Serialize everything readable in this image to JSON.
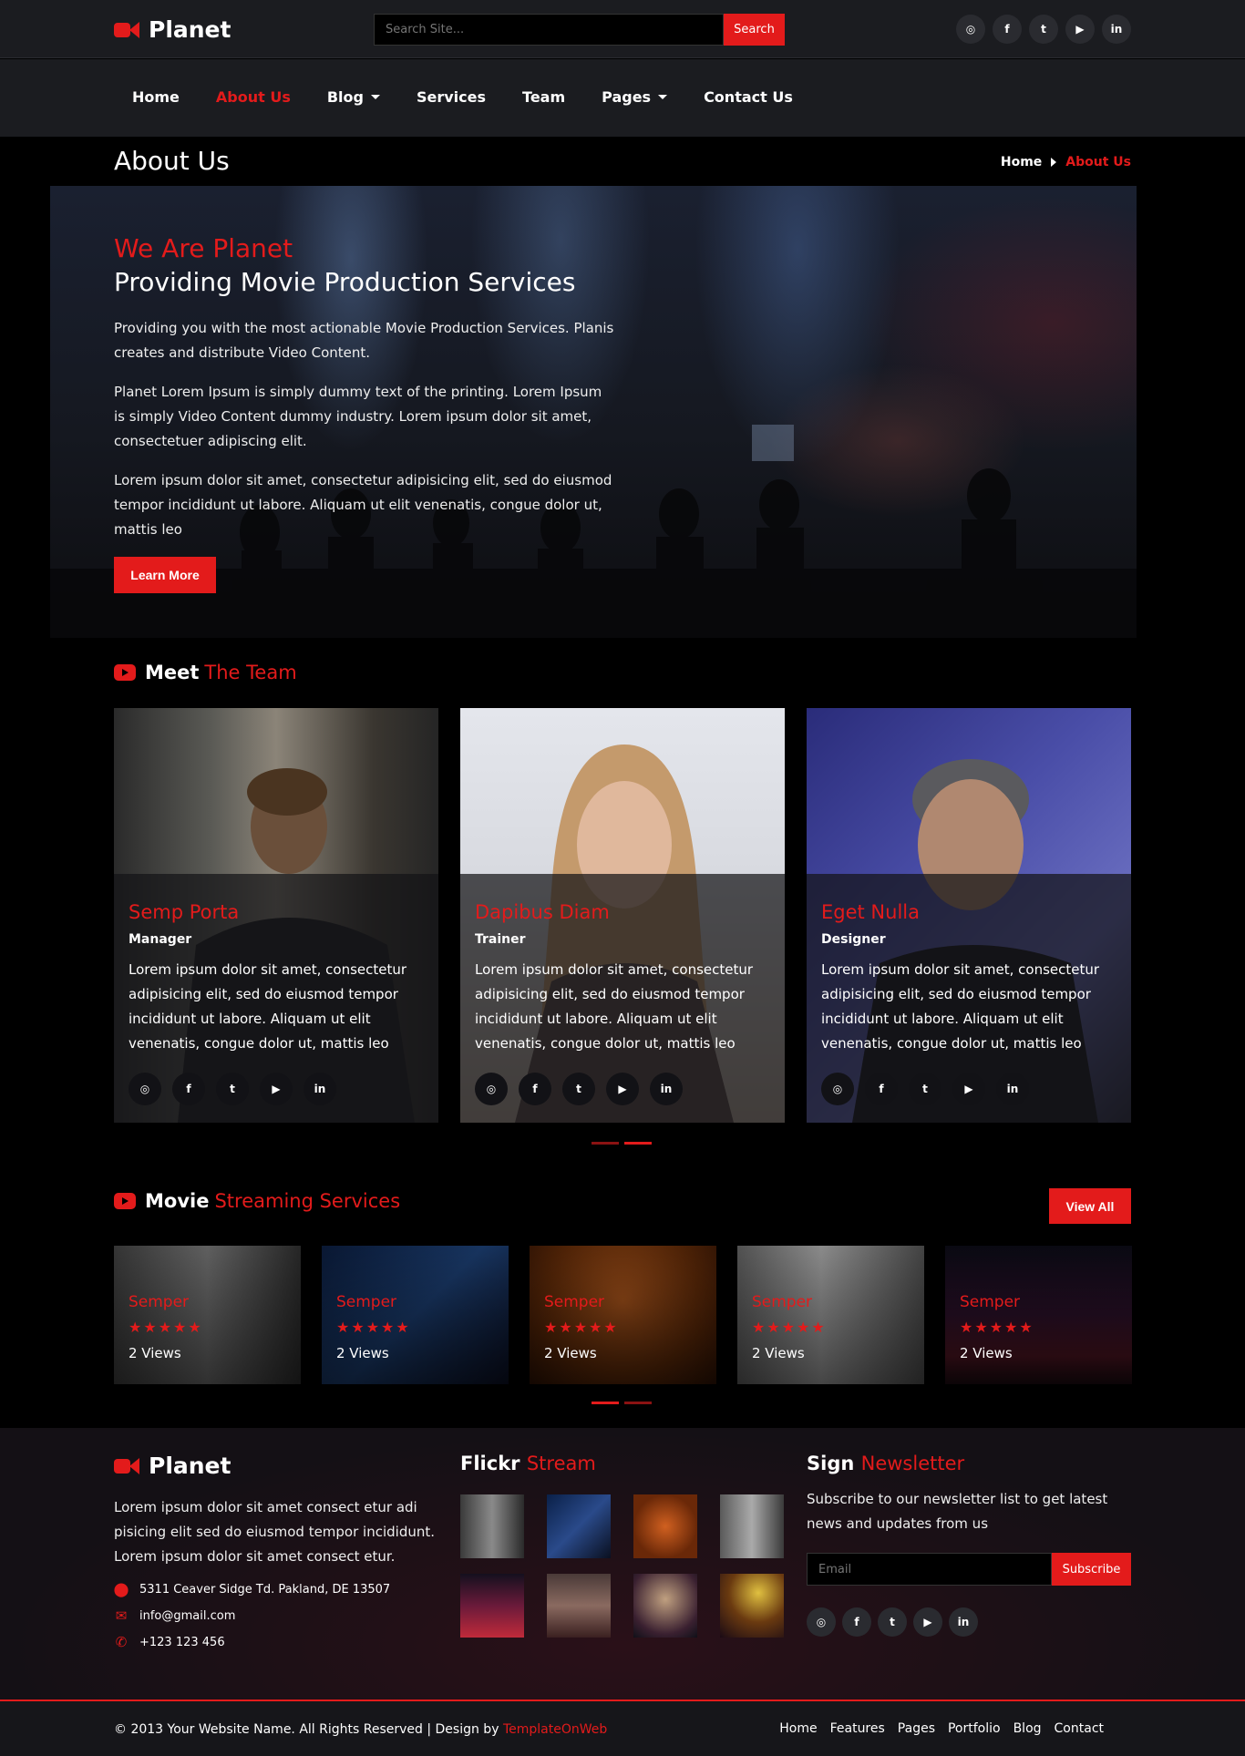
{
  "brand": {
    "name": "Planet"
  },
  "search": {
    "placeholder": "Search Site...",
    "button": "Search"
  },
  "social_icons": [
    {
      "icon": "instagram-icon",
      "glyph": "◎"
    },
    {
      "icon": "facebook-icon",
      "glyph": "f"
    },
    {
      "icon": "twitter-icon",
      "glyph": "🐦"
    },
    {
      "icon": "youtube-icon",
      "glyph": "▶"
    },
    {
      "icon": "linkedin-icon",
      "glyph": "in"
    }
  ],
  "nav": {
    "items": [
      "Home",
      "About Us",
      "Blog",
      "Services",
      "Team",
      "Pages",
      "Contact Us"
    ],
    "active": "About Us"
  },
  "page_title": {
    "title": "About Us",
    "breadcrumb_home": "Home",
    "breadcrumb_current": "About Us"
  },
  "hero": {
    "heading_red": "We Are Planet",
    "heading_white": "Providing Movie Production Services",
    "paragraphs": [
      "Providing you with the most actionable Movie Production Services. Planis creates and distribute Video Content.",
      "Planet Lorem Ipsum is simply dummy text of the printing. Lorem Ipsum is simply Video Content dummy industry. Lorem ipsum dolor sit amet, consectetuer adipiscing elit.",
      "Lorem ipsum dolor sit amet, consectetur adipisicing elit, sed do eiusmod tempor incididunt ut labore. Aliquam ut elit venenatis, congue dolor ut, mattis leo"
    ],
    "button": "Learn More"
  },
  "team_section": {
    "title_white": "Meet",
    "title_red": "The Team",
    "members": [
      {
        "name": "Semp Porta",
        "role": "Manager",
        "desc": "Lorem ipsum dolor sit amet, consectetur adipisicing elit, sed do eiusmod tempor incididunt ut labore. Aliquam ut elit venenatis, congue dolor ut, mattis leo"
      },
      {
        "name": "Dapibus Diam",
        "role": "Trainer",
        "desc": "Lorem ipsum dolor sit amet, consectetur adipisicing elit, sed do eiusmod tempor incididunt ut labore. Aliquam ut elit venenatis, congue dolor ut, mattis leo"
      },
      {
        "name": "Eget Nulla",
        "role": "Designer",
        "desc": "Lorem ipsum dolor sit amet, consectetur adipisicing elit, sed do eiusmod tempor incididunt ut labore. Aliquam ut elit venenatis, congue dolor ut, mattis leo"
      }
    ]
  },
  "movies_section": {
    "title_white": "Movie",
    "title_red": "Streaming Services",
    "view_all": "View All",
    "stars": "★★★★★",
    "items": [
      {
        "title": "Semper",
        "views": "2 Views"
      },
      {
        "title": "Semper",
        "views": "2 Views"
      },
      {
        "title": "Semper",
        "views": "2 Views"
      },
      {
        "title": "Semper",
        "views": "2 Views"
      },
      {
        "title": "Semper",
        "views": "2 Views"
      }
    ]
  },
  "footer": {
    "about": "Lorem ipsum dolor sit amet consect etur adi pisicing elit sed do eiusmod tempor incididunt. Lorem ipsum dolor sit amet consect etur.",
    "address": "5311 Ceaver Sidge Td. Pakland, DE 13507",
    "email": "info@gmail.com",
    "phone": "+123 123 456",
    "flickr_white": "Flickr",
    "flickr_red": "Stream",
    "newsletter_white": "Sign",
    "newsletter_red": "Newsletter",
    "newsletter_text": "Subscribe to our newsletter list to get latest news and updates from us",
    "email_placeholder": "Email",
    "subscribe": "Subscribe",
    "copyright": "© 2013 Your Website Name. All Rights Reserved | Design by ",
    "designer": "TemplateOnWeb",
    "links": [
      "Home",
      "Features",
      "Pages",
      "Portfolio",
      "Blog",
      "Contact"
    ]
  },
  "colors": {
    "accent": "#e31b1b",
    "bar": "#1b1c20",
    "background": "#000000"
  }
}
